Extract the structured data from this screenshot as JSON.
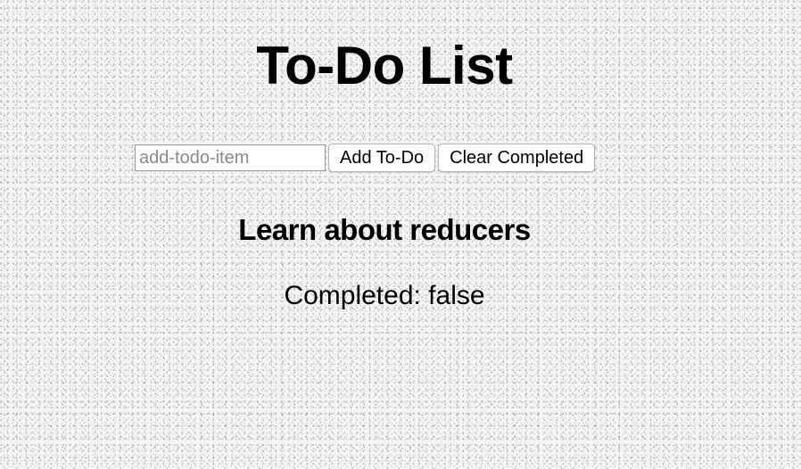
{
  "header": {
    "title": "To-Do List"
  },
  "form": {
    "input_placeholder": "add-todo-item",
    "input_value": "",
    "add_label": "Add To-Do",
    "clear_label": "Clear Completed"
  },
  "todos": [
    {
      "item": "Learn about reducers",
      "status_text": "Completed: false"
    }
  ]
}
